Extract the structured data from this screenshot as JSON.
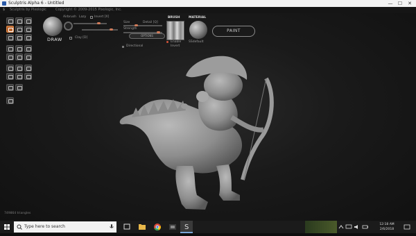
{
  "window": {
    "title": "Sculptris Alpha 6 - Untitled",
    "minimize": "—",
    "maximize": "☐",
    "close": "✕"
  },
  "menu": {
    "left": "Sculptris by Pixologic",
    "right": "Copyright © 2009-2015 Pixologic, Inc."
  },
  "brush": {
    "mode": "DRAW",
    "airbrush": "Airbrush",
    "lazy": "Lazy",
    "invert": "Invert [X]",
    "size": "Size",
    "detail": "Detail [Q]",
    "strength": "Strength",
    "clay": "Clay [D]",
    "options": "OPTIONS",
    "directional": "Directional"
  },
  "brush_panel": {
    "label": "BRUSH",
    "enable": "Enable",
    "invert": "Invert"
  },
  "material_panel": {
    "label": "MATERIAL",
    "name": "SSdefault"
  },
  "paint_button": "PAINT",
  "status": {
    "triangles": "749864 triangles"
  },
  "taskbar": {
    "search_placeholder": "Type here to search",
    "time": "12:18 AM",
    "date": "2/6/2018"
  }
}
